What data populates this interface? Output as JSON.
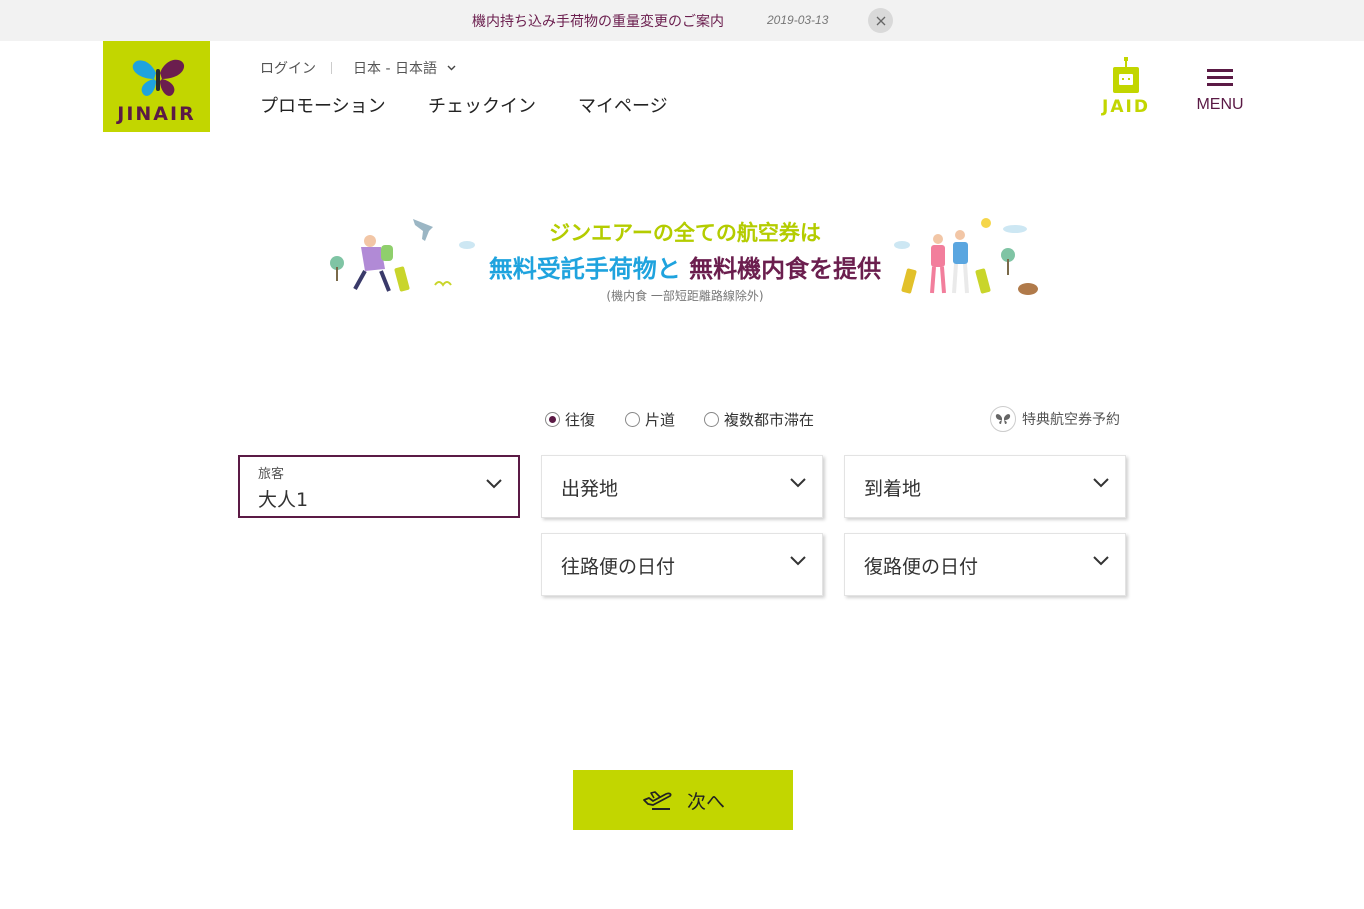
{
  "notice": {
    "title": "機内持ち込み手荷物の重量変更のご案内",
    "date": "2019-03-13"
  },
  "header": {
    "logo_text": "JINAIR",
    "login": "ログイン",
    "language": "日本 - 日本語",
    "nav": [
      "プロモーション",
      "チェックイン",
      "マイページ"
    ],
    "jaid_text": "JAID",
    "menu_label": "MENU"
  },
  "banner": {
    "line1": "ジンエアーの全ての航空券は",
    "line2_part1": "無料受託手荷物と",
    "line2_part2": "無料機内食を提供",
    "line3": "(機内食 一部短距離路線除外)"
  },
  "trip_type": {
    "options": [
      "往復",
      "片道",
      "複数都市滞在"
    ],
    "selected": 0,
    "award": "特典航空券予約"
  },
  "form": {
    "passenger_label": "旅客",
    "passenger_value": "大人1",
    "departure": "出発地",
    "arrival": "到着地",
    "outbound_date": "往路便の日付",
    "return_date": "復路便の日付"
  },
  "next_button": "次へ",
  "colors": {
    "brand_green": "#c2d600",
    "brand_purple": "#5b1a45",
    "banner_blue": "#1fa3de"
  }
}
